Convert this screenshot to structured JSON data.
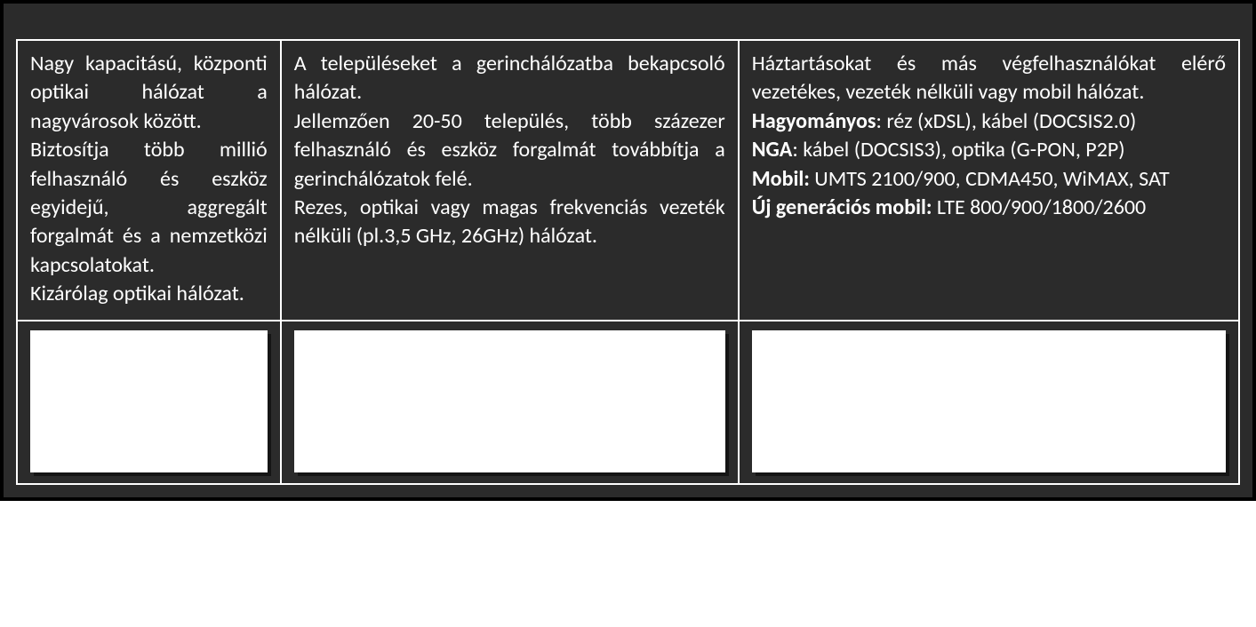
{
  "columns": [
    {
      "p1": "Nagy kapacitású, központi optikai hálózat a nagyvárosok között.",
      "p2": "Biztosítja több millió felhasználó és eszköz egyidejű, aggregált forgalmát és a nemzetközi kapcsolatokat.",
      "p3": "Kizárólag optikai hálózat."
    },
    {
      "p1": "A településeket a gerinchálózatba bekapcsoló hálózat.",
      "p2": "Jellemzően 20-50 település, több százezer felhasználó és eszköz forgalmát továbbítja a gerinchálózatok felé.",
      "p3": "Rezes, optikai vagy magas frekvenciás vezeték nélküli (pl.3,5 GHz, 26GHz) hálózat."
    },
    {
      "p1": "Háztartásokat és más végfelhasználókat elérő vezetékes, vezeték nélküli vagy mobil hálózat.",
      "l1_label": "Hagyományos",
      "l1_rest": ": réz (xDSL), kábel (DOCSIS2.0)",
      "l2_label": "NGA",
      "l2_rest": ": kábel (DOCSIS3), optika (G-PON, P2P)",
      "l3_label": "Mobil:",
      "l3_rest": " UMTS 2100/900, CDMA450, WiMAX, SAT",
      "l4_label": "Új generációs mobil:",
      "l4_rest": " LTE 800/900/1800/2600"
    }
  ]
}
